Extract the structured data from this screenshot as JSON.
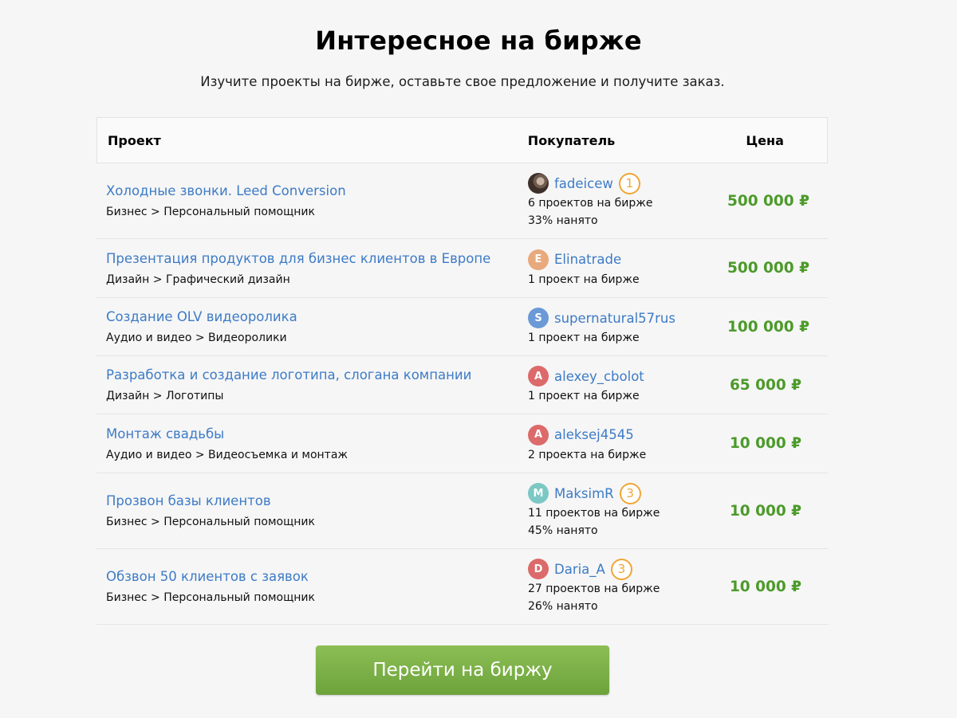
{
  "header": {
    "title": "Интересное на бирже",
    "subtitle": "Изучите проекты на бирже, оставьте свое предложение и получите заказ."
  },
  "table": {
    "columns": {
      "project": "Проект",
      "buyer": "Покупатель",
      "price": "Цена"
    },
    "rows": [
      {
        "title": "Холодные звонки. Leed Conversion",
        "category": "Бизнес > Персональный помощник",
        "buyer": {
          "name": "fadeicew",
          "avatar": "",
          "avatar_color": "",
          "badge": "1",
          "projects": "6 проектов на бирже",
          "hired": "33% нанято"
        },
        "price": "500 000 ₽"
      },
      {
        "title": "Презентация продуктов для бизнес клиентов в Европе",
        "category": "Дизайн > Графический дизайн",
        "buyer": {
          "name": "Elinatrade",
          "avatar": "E",
          "avatar_color": "#e8a97c",
          "badge": "",
          "projects": "1 проект на бирже",
          "hired": ""
        },
        "price": "500 000 ₽"
      },
      {
        "title": "Создание OLV видеоролика",
        "category": "Аудио и видео > Видеоролики",
        "buyer": {
          "name": "supernatural57rus",
          "avatar": "S",
          "avatar_color": "#6b9ad6",
          "badge": "",
          "projects": "1 проект на бирже",
          "hired": ""
        },
        "price": "100 000 ₽"
      },
      {
        "title": "Разработка и создание логотипа, слогана компании",
        "category": "Дизайн > Логотипы",
        "buyer": {
          "name": "alexey_cbolot",
          "avatar": "A",
          "avatar_color": "#dc6a6a",
          "badge": "",
          "projects": "1 проект на бирже",
          "hired": ""
        },
        "price": "65 000 ₽"
      },
      {
        "title": "Монтаж свадьбы",
        "category": "Аудио и видео > Видеосъемка и монтаж",
        "buyer": {
          "name": "aleksej4545",
          "avatar": "A",
          "avatar_color": "#dc6a6a",
          "badge": "",
          "projects": "2 проекта на бирже",
          "hired": ""
        },
        "price": "10 000 ₽"
      },
      {
        "title": "Прозвон базы клиентов",
        "category": "Бизнес > Персональный помощник",
        "buyer": {
          "name": "MaksimR",
          "avatar": "M",
          "avatar_color": "#7cc8c4",
          "badge": "3",
          "projects": "11 проектов на бирже",
          "hired": "45% нанято"
        },
        "price": "10 000 ₽"
      },
      {
        "title": "Обзвон 50 клиентов с заявок",
        "category": "Бизнес > Персональный помощник",
        "buyer": {
          "name": "Daria_A",
          "avatar": "D",
          "avatar_color": "#dc6a6a",
          "badge": "3",
          "projects": "27 проектов на бирже",
          "hired": "26% нанято"
        },
        "price": "10 000 ₽"
      }
    ]
  },
  "cta": {
    "label": "Перейти на биржу"
  }
}
